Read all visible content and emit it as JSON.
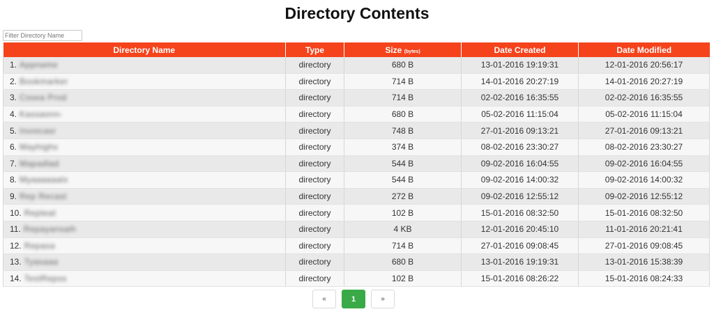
{
  "page": {
    "title": "Directory Contents"
  },
  "filter": {
    "placeholder": "Filter Directory Name",
    "value": ""
  },
  "table": {
    "headers": {
      "name": "Directory Name",
      "type": "Type",
      "size": "Size",
      "size_unit": "(bytes)",
      "created": "Date Created",
      "modified": "Date Modified"
    },
    "rows": [
      {
        "index": "1.",
        "name": "Appname",
        "type": "directory",
        "size": "680 B",
        "created": "13-01-2016 19:19:31",
        "modified": "12-01-2016 20:56:17"
      },
      {
        "index": "2.",
        "name": "Bookmarker",
        "type": "directory",
        "size": "714 B",
        "created": "14-01-2016 20:27:19",
        "modified": "14-01-2016 20:27:19"
      },
      {
        "index": "3.",
        "name": "Cssea Prod",
        "type": "directory",
        "size": "714 B",
        "created": "02-02-2016 16:35:55",
        "modified": "02-02-2016 16:35:55"
      },
      {
        "index": "4.",
        "name": "Kassaonn-",
        "type": "directory",
        "size": "680 B",
        "created": "05-02-2016 11:15:04",
        "modified": "05-02-2016 11:15:04"
      },
      {
        "index": "5.",
        "name": "Invoicasr",
        "type": "directory",
        "size": "748 B",
        "created": "27-01-2016 09:13:21",
        "modified": "27-01-2016 09:13:21"
      },
      {
        "index": "6.",
        "name": "Mayhighs",
        "type": "directory",
        "size": "374 B",
        "created": "08-02-2016 23:30:27",
        "modified": "08-02-2016 23:30:27"
      },
      {
        "index": "7.",
        "name": "Mapadlad",
        "type": "directory",
        "size": "544 B",
        "created": "09-02-2016 16:04:55",
        "modified": "09-02-2016 16:04:55"
      },
      {
        "index": "8.",
        "name": "Myaaaaaalx",
        "type": "directory",
        "size": "544 B",
        "created": "09-02-2016 14:00:32",
        "modified": "09-02-2016 14:00:32"
      },
      {
        "index": "9.",
        "name": "Rep Recast",
        "type": "directory",
        "size": "272 B",
        "created": "09-02-2016 12:55:12",
        "modified": "09-02-2016 12:55:12"
      },
      {
        "index": "10.",
        "name": "Repteat",
        "type": "directory",
        "size": "102 B",
        "created": "15-01-2016 08:32:50",
        "modified": "15-01-2016 08:32:50"
      },
      {
        "index": "11.",
        "name": "Repayansaih",
        "type": "directory",
        "size": "4 KB",
        "created": "12-01-2016 20:45:10",
        "modified": "11-01-2016 20:21:41"
      },
      {
        "index": "12.",
        "name": "Repasa",
        "type": "directory",
        "size": "714 B",
        "created": "27-01-2016 09:08:45",
        "modified": "27-01-2016 09:08:45"
      },
      {
        "index": "13.",
        "name": "Tyasaaa",
        "type": "directory",
        "size": "680 B",
        "created": "13-01-2016 19:19:31",
        "modified": "13-01-2016 15:38:39"
      },
      {
        "index": "14.",
        "name": "TestRepos",
        "type": "directory",
        "size": "102 B",
        "created": "15-01-2016 08:26:22",
        "modified": "15-01-2016 08:24:33"
      }
    ]
  },
  "pagination": {
    "prev": "«",
    "current": "1",
    "next": "»"
  },
  "colors": {
    "header_bg": "#f5431c",
    "active_page": "#3aaa48",
    "row_odd": "#e9e9e9",
    "row_even": "#f7f7f7"
  }
}
